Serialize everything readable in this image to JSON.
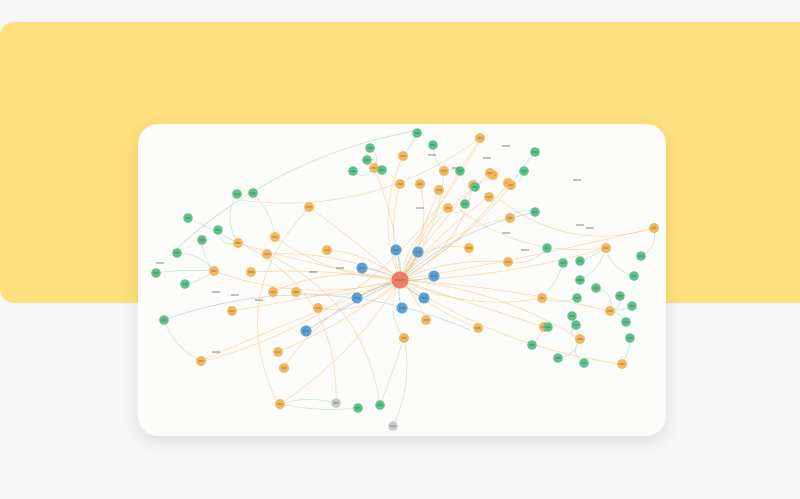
{
  "colors": {
    "page_background": "#f7f7f7",
    "banner": "#ffe07e",
    "card": "#fcfcfa",
    "center_node": "#f07b64",
    "primary_node": "#5b9fd4",
    "secondary_node": "#f6b65a",
    "leaf_node": "#5ec08a",
    "inactive_node": "#c8c8c8",
    "edge_warm": "#f7c992",
    "edge_cool": "#9cc7e3",
    "edge_green": "#a9d8bb"
  },
  "graph": {
    "title": "",
    "node_types": [
      "center",
      "primary",
      "secondary",
      "leaf",
      "inactive"
    ],
    "node_labels_legible": false
  }
}
